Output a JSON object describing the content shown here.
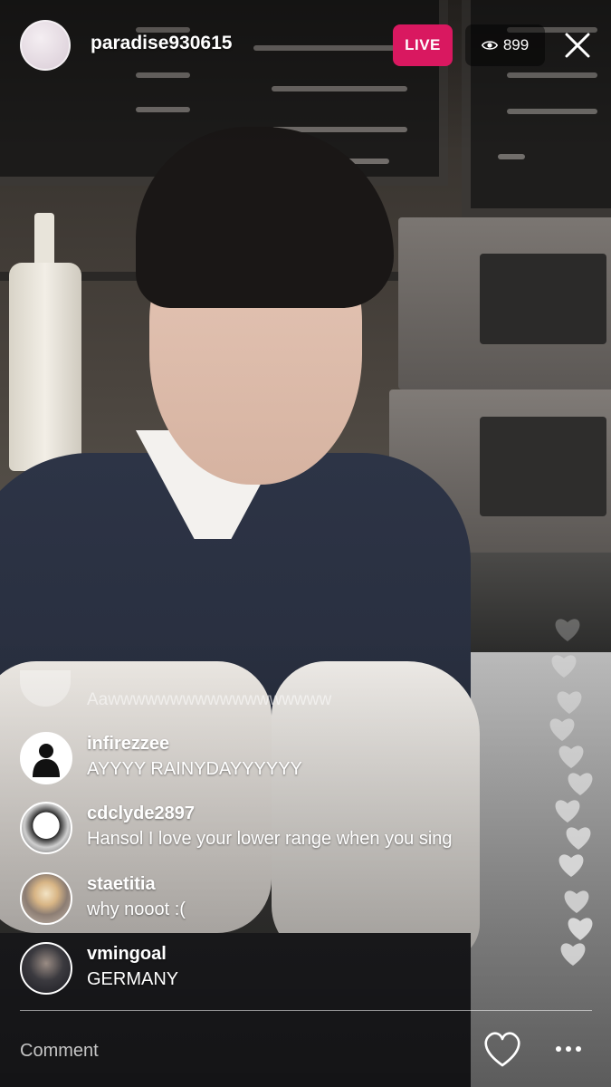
{
  "header": {
    "username": "paradise930615",
    "live_label": "LIVE",
    "viewer_count": "899"
  },
  "comments": {
    "faded": "Aawwwwwwwwwwwwwwwwww",
    "items": [
      {
        "username": "infirezzee",
        "text": "AYYYY RAINYDAYYYYYY"
      },
      {
        "username": "cdclyde2897",
        "text": "Hansol I love your lower range when you sing"
      },
      {
        "username": "staetitia",
        "text": "why nooot :("
      },
      {
        "username": "vmingoal",
        "text": "GERMANY"
      }
    ]
  },
  "footer": {
    "comment_placeholder": "Comment"
  },
  "colors": {
    "live_badge": "#d91860",
    "text": "#ffffff"
  },
  "icons": [
    "eye-icon",
    "close-icon",
    "heart-icon",
    "more-icon"
  ]
}
